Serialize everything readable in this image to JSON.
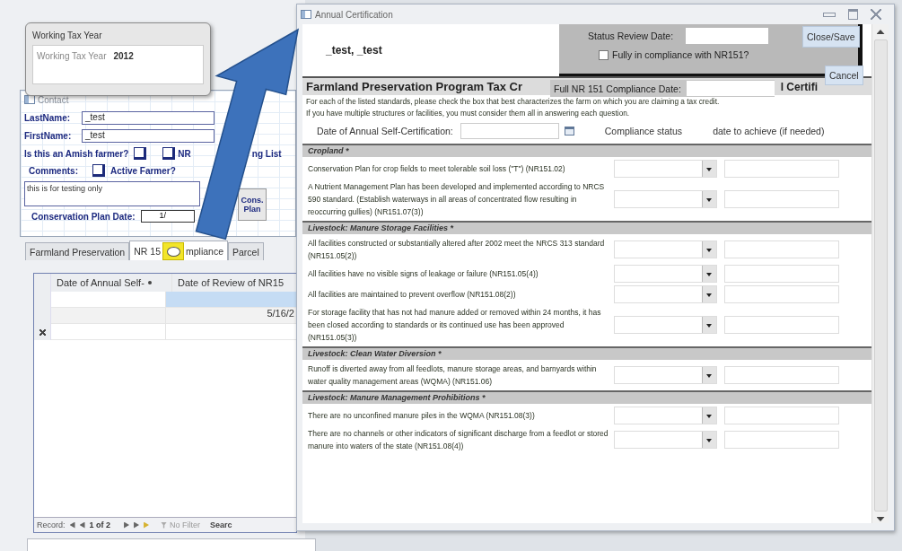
{
  "main_form": {
    "tax_year_popup": {
      "title": "Working Tax Year",
      "label": "Working Tax Year",
      "value": "2012"
    },
    "contact": {
      "title": "Contact",
      "fields": [
        {
          "label": "LastName:",
          "value": "_test"
        },
        {
          "label": "FirstName:",
          "value": "_test"
        }
      ],
      "amish": {
        "label": "Is this an Amish farmer?",
        "checked": false
      },
      "mailing_list": {
        "label_parts": [
          "NR",
          "ng List"
        ],
        "checked": false
      },
      "comments_label": "Comments:",
      "active_farmer": {
        "label": "Active Farmer?",
        "checked": false
      },
      "comments": "this is for testing only",
      "cons_plan_button": "Cons. Plan",
      "plan_date": {
        "label": "Conservation Plan Date:",
        "value": "1/"
      }
    },
    "tabs": [
      {
        "label_parts": [
          "Farmland Preservation"
        ],
        "selected": false
      },
      {
        "label_parts": [
          "NR 15",
          "mpliance"
        ],
        "selected": true
      },
      {
        "label_parts": [
          "Parcel"
        ],
        "selected": false
      }
    ],
    "datasheet": {
      "columns": [
        "Date of Annual Self-",
        "Date of Review of NR15"
      ],
      "rows": [
        {
          "selected": true
        },
        {
          "selected": false,
          "column_2": "5/16/2"
        }
      ]
    },
    "record_nav": {
      "label": "Record:",
      "position": "1 of 2",
      "filter": "No Filter",
      "search": "Searc"
    }
  },
  "dialog": {
    "title": "Annual Certification",
    "farmer_name": "_test, _test",
    "status_review": {
      "label": "Status Review Date:"
    },
    "fully_compliant": {
      "label": "Fully in compliance with NR151?",
      "checked": false
    },
    "buttons": [
      {
        "label": "Close/Save"
      },
      {
        "label": "Cancel"
      }
    ],
    "full_compliance_date": {
      "label": "Full NR 151 Compliance Date:"
    },
    "heading": "Farmland Preservation Program Tax Cr",
    "heading_tail": "l Certifi",
    "instructions": [
      "For each of the listed standards, please check the box that best characterizes the farm on which you are claiming a tax credit.",
      "If you have multiple structures or facilities, you must consider them all in answering each question."
    ],
    "self_certification_date": {
      "label": "Date of Annual Self-Certification:"
    },
    "columns": [
      "Compliance status",
      "date to achieve (if needed)"
    ],
    "sections": [
      {
        "title": "Cropland *",
        "items": [
          {
            "text": "Conservation Plan for crop fields to meet tolerable soil loss (\"T\") (NR151.02)"
          },
          {
            "text": "A Nutrient Management Plan has been developed and implemented according to NRCS 590 standard.  (Establish waterways in all areas of concentrated flow resulting in reoccurring gullies)  (NR151.07(3))"
          }
        ]
      },
      {
        "title": "Livestock: Manure Storage Facilities *",
        "items": [
          {
            "text": "All facilities constructed or substantially altered after 2002 meet the NRCS 313 standard  (NR151.05(2))"
          },
          {
            "text": "All facilities have no visible signs of leakage or failure (NR151.05(4))"
          },
          {
            "text": "All facilities are maintained to prevent overflow  (NR151.08(2))"
          },
          {
            "text": "For storage facility that has not had manure added or removed within 24 months, it has been closed according to standards or its continued use has been approved  (NR151.05(3))"
          }
        ]
      },
      {
        "title": "Livestock: Clean Water Diversion *",
        "items": [
          {
            "text": "Runoff is diverted away from all feedlots, manure storage areas, and barnyards within water quality management areas (WQMA) (NR151.06)"
          }
        ]
      },
      {
        "title": "Livestock: Manure Management Prohibitions *",
        "items": [
          {
            "text": "There are no unconfined manure piles in the WQMA  (NR151.08(3))"
          },
          {
            "text": "There are no channels or other indicators of significant discharge from a feedlot  or stored manure into waters of the state  (NR151.08(4))"
          }
        ]
      }
    ]
  }
}
